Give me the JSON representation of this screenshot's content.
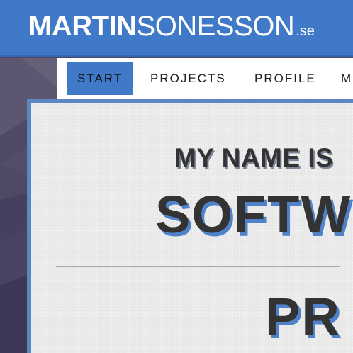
{
  "header": {
    "logo_bold": "MARTIN",
    "logo_thin": "SONESSON",
    "logo_tld": ".se"
  },
  "nav": {
    "items": [
      {
        "label": "START",
        "active": true
      },
      {
        "label": "PROJECTS",
        "active": false
      },
      {
        "label": "PROFILE",
        "active": false
      },
      {
        "label": "M",
        "active": false
      }
    ]
  },
  "main": {
    "intro": "MY NAME IS",
    "headline": "SOFTW",
    "subhead": "PR"
  },
  "colors": {
    "brand_blue": "#3f79c7",
    "panel_bg": "#ececec",
    "text_dark": "#333333",
    "left_bg": "#4a4462"
  }
}
